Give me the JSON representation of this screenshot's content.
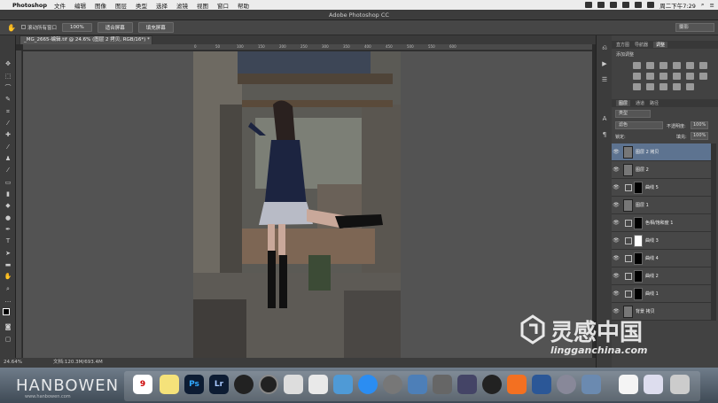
{
  "menubar": {
    "app_name": "Photoshop",
    "items": [
      "文件",
      "编辑",
      "图像",
      "图层",
      "类型",
      "选择",
      "滤镜",
      "视图",
      "窗口",
      "帮助"
    ],
    "clock": "周二下午7:29"
  },
  "window": {
    "title": "Adobe Photoshop CC"
  },
  "options_bar": {
    "scroll_all_label": "滚动所有窗口",
    "zoom_value": "100%",
    "fit_screen_label": "适合屏幕",
    "fill_screen_label": "填充屏幕",
    "workspace": "摄影"
  },
  "document": {
    "tab_title": "_MG_2665-编辑.tif @ 24.6% (图层 2 拷贝, RGB/16*) *"
  },
  "rulers": {
    "h_ticks": [
      "0",
      "50",
      "100",
      "150",
      "200",
      "250",
      "300",
      "350",
      "400",
      "450",
      "500",
      "550",
      "600"
    ]
  },
  "statusbar": {
    "zoom": "24.64%",
    "doc_size": "文档:120.3M/693.4M"
  },
  "panels": {
    "top_tabs": [
      "直方图",
      "导航器",
      "调整"
    ],
    "adjust_title": "添加调整",
    "layer_tabs": [
      "图层",
      "通道",
      "路径"
    ],
    "filter_kind": "类型",
    "blend_mode": "滤色",
    "opacity_label": "不透明度:",
    "opacity_value": "100%",
    "lock_label": "锁定:",
    "fill_label": "填充:",
    "fill_value": "100%",
    "layers": [
      {
        "name": "图层 2 拷贝",
        "type": "pixel",
        "selected": true
      },
      {
        "name": "图层 2",
        "type": "pixel",
        "selected": false
      },
      {
        "name": "曲线 5",
        "type": "adjust",
        "mask": "black"
      },
      {
        "name": "图层 1",
        "type": "pixel",
        "selected": false
      },
      {
        "name": "色相/饱和度 1",
        "type": "adjust",
        "mask": "black"
      },
      {
        "name": "曲线 3",
        "type": "adjust",
        "mask": "white"
      },
      {
        "name": "曲线 4",
        "type": "adjust",
        "mask": "black"
      },
      {
        "name": "曲线 2",
        "type": "adjust",
        "mask": "black"
      },
      {
        "name": "曲线 1",
        "type": "adjust",
        "mask": "black"
      },
      {
        "name": "背景 拷贝",
        "type": "pixel",
        "selected": false
      }
    ]
  },
  "watermarks": {
    "site_logo_text": "灵感中国",
    "site_url": "lingganchina.com",
    "author": "HANBOWEN",
    "author_url": "www.hanbowen.com"
  },
  "dock": {
    "calendar_day": "9",
    "apps": [
      "Ps",
      "Lr"
    ]
  }
}
